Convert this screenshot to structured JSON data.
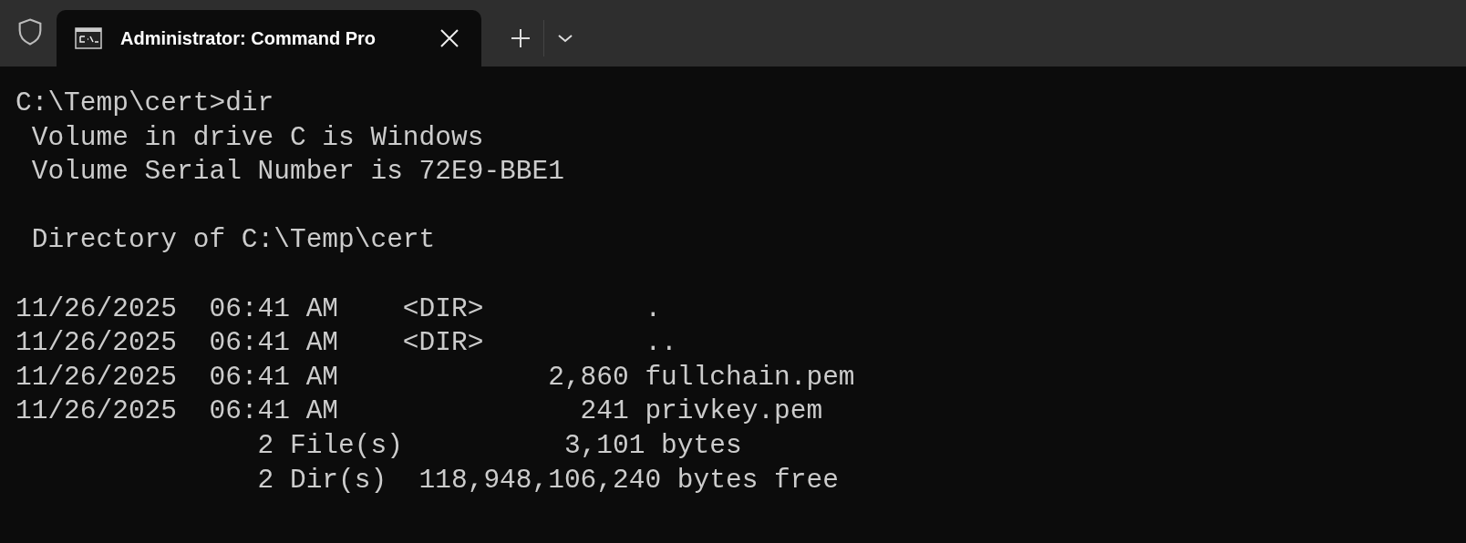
{
  "tab": {
    "title": "Administrator: Command Pro",
    "selected": true
  },
  "output_blocks": [
    [
      "C:\\Temp\\cert>dir",
      " Volume in drive C is Windows",
      " Volume Serial Number is 72E9-BBE1"
    ],
    [
      " Directory of C:\\Temp\\cert"
    ],
    [
      "11/26/2025  06:41 AM    <DIR>          .",
      "11/26/2025  06:41 AM    <DIR>          ..",
      "11/26/2025  06:41 AM             2,860 fullchain.pem",
      "11/26/2025  06:41 AM               241 privkey.pem",
      "               2 File(s)          3,101 bytes",
      "               2 Dir(s)  118,948,106,240 bytes free"
    ]
  ]
}
